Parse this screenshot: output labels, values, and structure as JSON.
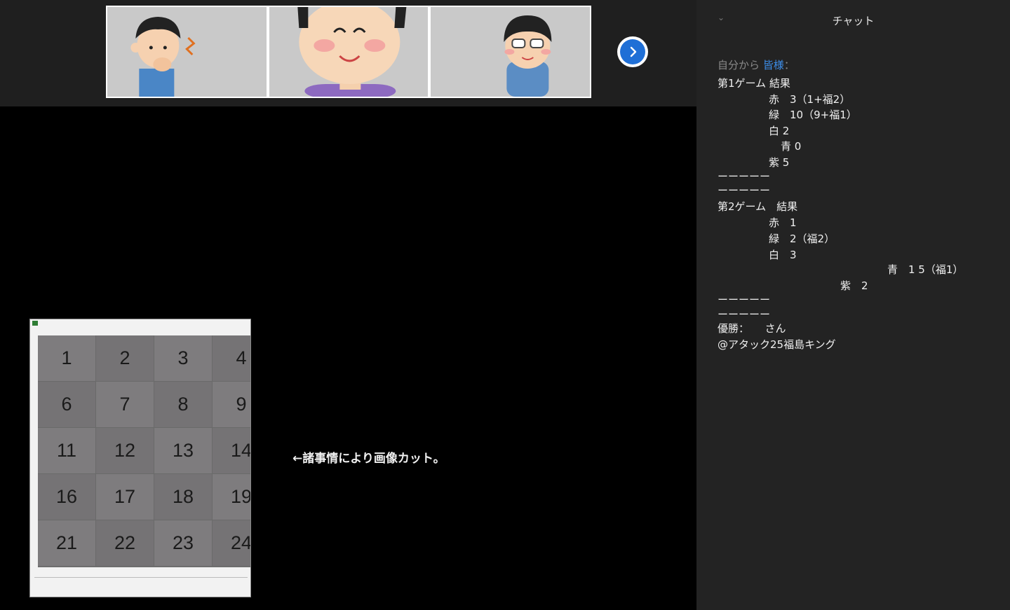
{
  "video_strip": {
    "thumbnails": [
      {
        "name": "participant-1"
      },
      {
        "name": "participant-2"
      },
      {
        "name": "participant-3"
      }
    ],
    "next_icon": "chevron-right-icon"
  },
  "bingo": {
    "numbers": [
      "1",
      "2",
      "3",
      "4",
      "6",
      "7",
      "8",
      "9",
      "11",
      "12",
      "13",
      "14",
      "16",
      "17",
      "18",
      "19",
      "21",
      "22",
      "23",
      "24"
    ]
  },
  "stage_note": "←諸事情により画像カット。",
  "chat": {
    "collapse_icon": "chevron-down-icon",
    "title": "チャット",
    "from_label": "自分から",
    "to_label": "皆様",
    "to_suffix": "：",
    "lines": [
      "第1ゲーム 結果",
      "赤　3（1+福2）",
      "緑　10（9+福1）",
      "白 2",
      "青 0",
      "紫 5",
      "ーーーーー",
      "ーーーーー",
      "第2ゲーム　結果",
      "赤　1",
      "緑　2（福2）",
      "白　3",
      "青　1 5（福1）",
      "紫　2",
      "ーーーーー",
      "ーーーーー",
      "優勝：　　さん",
      "@アタック25福島キング"
    ]
  },
  "colors": {
    "accent": "#1f6fd6",
    "chat_bg": "#232323",
    "recipient": "#3d8ee9"
  }
}
